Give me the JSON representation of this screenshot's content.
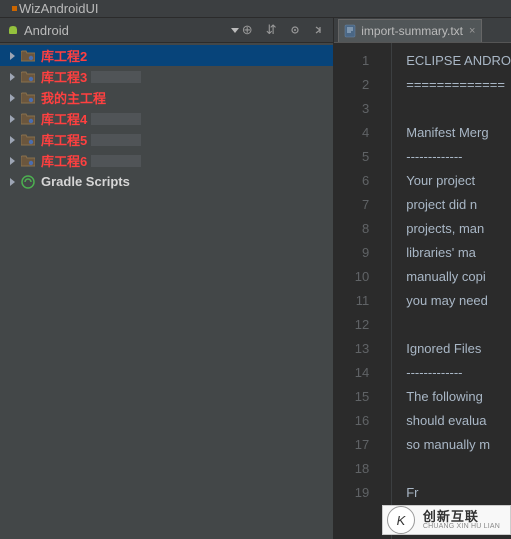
{
  "window": {
    "title": "WizAndroidUI"
  },
  "leftHeader": {
    "label": "Android",
    "icons": {
      "target": "⊕",
      "split": "⇵",
      "gear": "✻",
      "collapse": "←"
    }
  },
  "tree": {
    "items": [
      {
        "label": "库工程2",
        "red": true,
        "smudge": false,
        "selected": true
      },
      {
        "label": "库工程3",
        "red": true,
        "smudge": true,
        "selected": false
      },
      {
        "label": "我的主工程",
        "red": true,
        "smudge": false,
        "selected": false
      },
      {
        "label": "库工程4",
        "red": true,
        "smudge": true,
        "selected": false
      },
      {
        "label": "库工程5",
        "red": true,
        "smudge": true,
        "selected": false
      },
      {
        "label": "库工程6",
        "red": true,
        "smudge": true,
        "selected": false
      },
      {
        "label": "Gradle Scripts",
        "red": false,
        "smudge": false,
        "selected": false,
        "gradle": true
      }
    ]
  },
  "tab": {
    "label": "import-summary.txt",
    "close": "×"
  },
  "editor": {
    "lines": [
      {
        "num": "1",
        "text": "ECLIPSE ANDRO"
      },
      {
        "num": "2",
        "text": "============="
      },
      {
        "num": "3",
        "text": ""
      },
      {
        "num": "4",
        "text": "Manifest Merg"
      },
      {
        "num": "5",
        "text": "-------------"
      },
      {
        "num": "6",
        "text": "Your project "
      },
      {
        "num": "7",
        "text": "project did n"
      },
      {
        "num": "8",
        "text": "projects, man"
      },
      {
        "num": "9",
        "text": "libraries' ma"
      },
      {
        "num": "10",
        "text": "manually copi"
      },
      {
        "num": "11",
        "text": "you may need "
      },
      {
        "num": "12",
        "text": ""
      },
      {
        "num": "13",
        "text": "Ignored Files"
      },
      {
        "num": "14",
        "text": "-------------"
      },
      {
        "num": "15",
        "text": "The following"
      },
      {
        "num": "16",
        "text": "should evalua"
      },
      {
        "num": "17",
        "text": "so manually m"
      },
      {
        "num": "18",
        "text": ""
      },
      {
        "num": "19",
        "text": "Fr"
      }
    ]
  },
  "watermark": {
    "logo": "K",
    "cn": "创新互联",
    "py": "CHUANG XIN HU LIAN"
  }
}
